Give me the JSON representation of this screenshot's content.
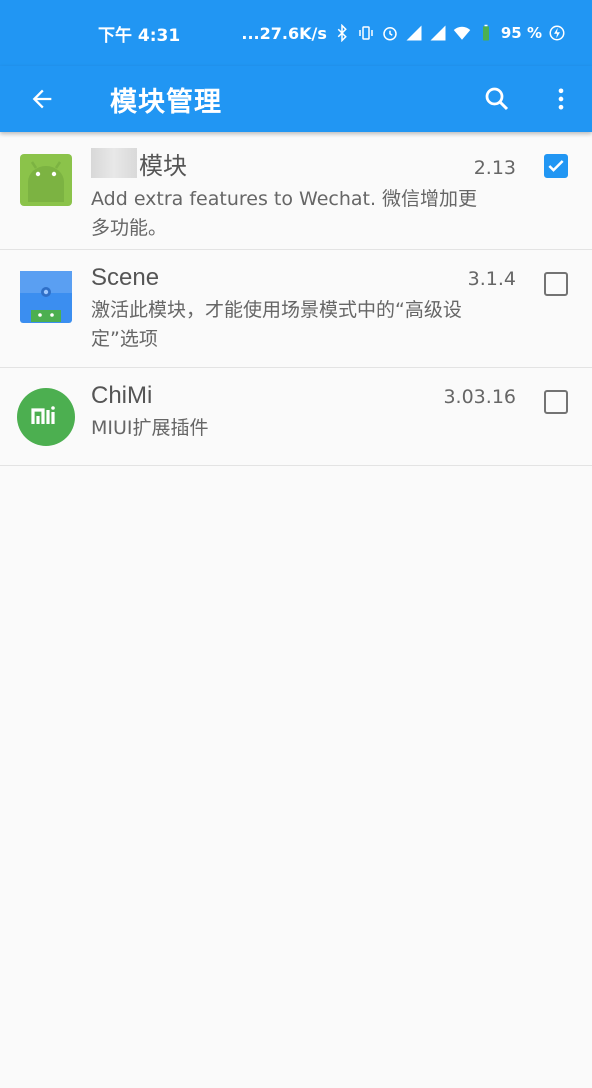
{
  "status_bar": {
    "time": "下午 4:31",
    "network_speed": "...27.6K/s",
    "battery": "95 %"
  },
  "app_bar": {
    "title": "模块管理",
    "icons": [
      "arrow-back-icon",
      "search-icon",
      "more-vert-icon"
    ]
  },
  "modules": [
    {
      "title": "模块",
      "title_prefix_blurred": true,
      "version": "2.13",
      "description": "Add extra features to Wechat. 微信增加更多功能。",
      "icon": "android-icon",
      "checked": true
    },
    {
      "title": "Scene",
      "version": "3.1.4",
      "description": "激活此模块，才能使用场景模式中的“高级设定”选项",
      "icon": "scene-app-icon",
      "checked": false
    },
    {
      "title": "ChiMi",
      "version": "3.03.16",
      "description": "MIUI扩展插件",
      "icon": "chimi-mi-icon",
      "checked": false
    }
  ],
  "colors": {
    "primary": "#2196f3",
    "android_green": "#a4c639",
    "chimi_green": "#4caf50"
  }
}
